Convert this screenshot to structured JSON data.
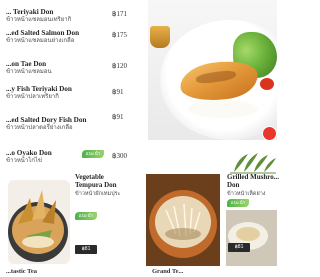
{
  "menu": {
    "items": [
      {
        "name": "... Teriyaki Don",
        "sub": "ข้าวหน้าแซลมอนเทริยากิ",
        "price": "฿171"
      },
      {
        "name": "...ed Salted Salmon Don",
        "sub": "ข้าวหน้าแซลมอนย่างเกลือ",
        "price": "฿175"
      },
      {
        "name": "...on Tae Don",
        "sub": "ข้าวหน้าแซลมอน",
        "price": "฿120"
      },
      {
        "name": "...y Fish Teriyaki Don",
        "sub": "ข้าวหน้าปลาเทริยากิ",
        "price": "฿91"
      },
      {
        "name": "...ed Salted Dory Fish Don",
        "sub": "ข้าวหน้าปลาดอรี่ย่างเกลือ",
        "price": "฿91"
      },
      {
        "name": "...o Oyako Don",
        "sub": "ข้าวหน้าไก่ไข่",
        "price": "฿300",
        "badge": "แนะนำ"
      }
    ]
  },
  "cards": [
    {
      "name": "Vegetable",
      "name2": "Tempura Don",
      "sub": "ข้าวหน้าผักเทมปุระ",
      "badge": "แนะนำ",
      "price": "฿81"
    },
    {
      "name": "Grilled Mushro...",
      "name2": "Don",
      "sub": "ข้าวหน้าเห็ดย่าง",
      "badge": "แนะนำ",
      "price": "฿81"
    }
  ],
  "bottom": {
    "left": "...tastic Tea",
    "mid": "Grand Te..."
  },
  "colors": {
    "badge_green": "#4fb24a",
    "dot_red": "#e8362b",
    "price_tag": "#2a2a2a"
  }
}
